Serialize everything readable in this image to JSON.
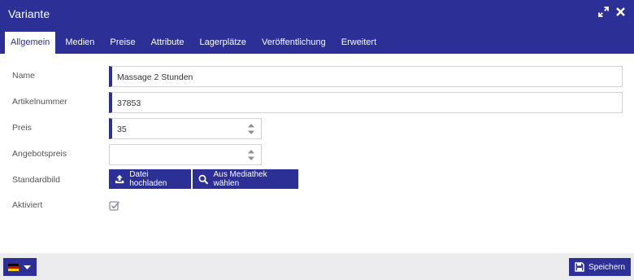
{
  "dialog": {
    "title": "Variante",
    "controls": {
      "expand_icon": "expand-icon",
      "close_icon": "close-icon"
    }
  },
  "tabs": [
    {
      "label": "Allgemein",
      "active": true
    },
    {
      "label": "Medien",
      "active": false
    },
    {
      "label": "Preise",
      "active": false
    },
    {
      "label": "Attribute",
      "active": false
    },
    {
      "label": "Lagerplätze",
      "active": false
    },
    {
      "label": "Veröffentlichung",
      "active": false
    },
    {
      "label": "Erweitert",
      "active": false
    }
  ],
  "form": {
    "name": {
      "label": "Name",
      "value": "Massage 2 Stunden",
      "required": true
    },
    "artikelnummer": {
      "label": "Artikelnummer",
      "value": "37853",
      "required": true
    },
    "preis": {
      "label": "Preis",
      "value": "35",
      "required": true
    },
    "angebotspreis": {
      "label": "Angebotspreis",
      "value": "",
      "required": false
    },
    "standardbild": {
      "label": "Standardbild",
      "upload_label": "Datei hochladen",
      "media_label": "Aus Mediathek wählen"
    },
    "aktiviert": {
      "label": "Aktiviert",
      "checked": true
    }
  },
  "footer": {
    "language_icon": "germany-flag-icon",
    "save_label": "Speichern"
  },
  "colors": {
    "accent": "#2b2f96",
    "footer_bg": "#ececef",
    "border": "#cfd2da"
  }
}
